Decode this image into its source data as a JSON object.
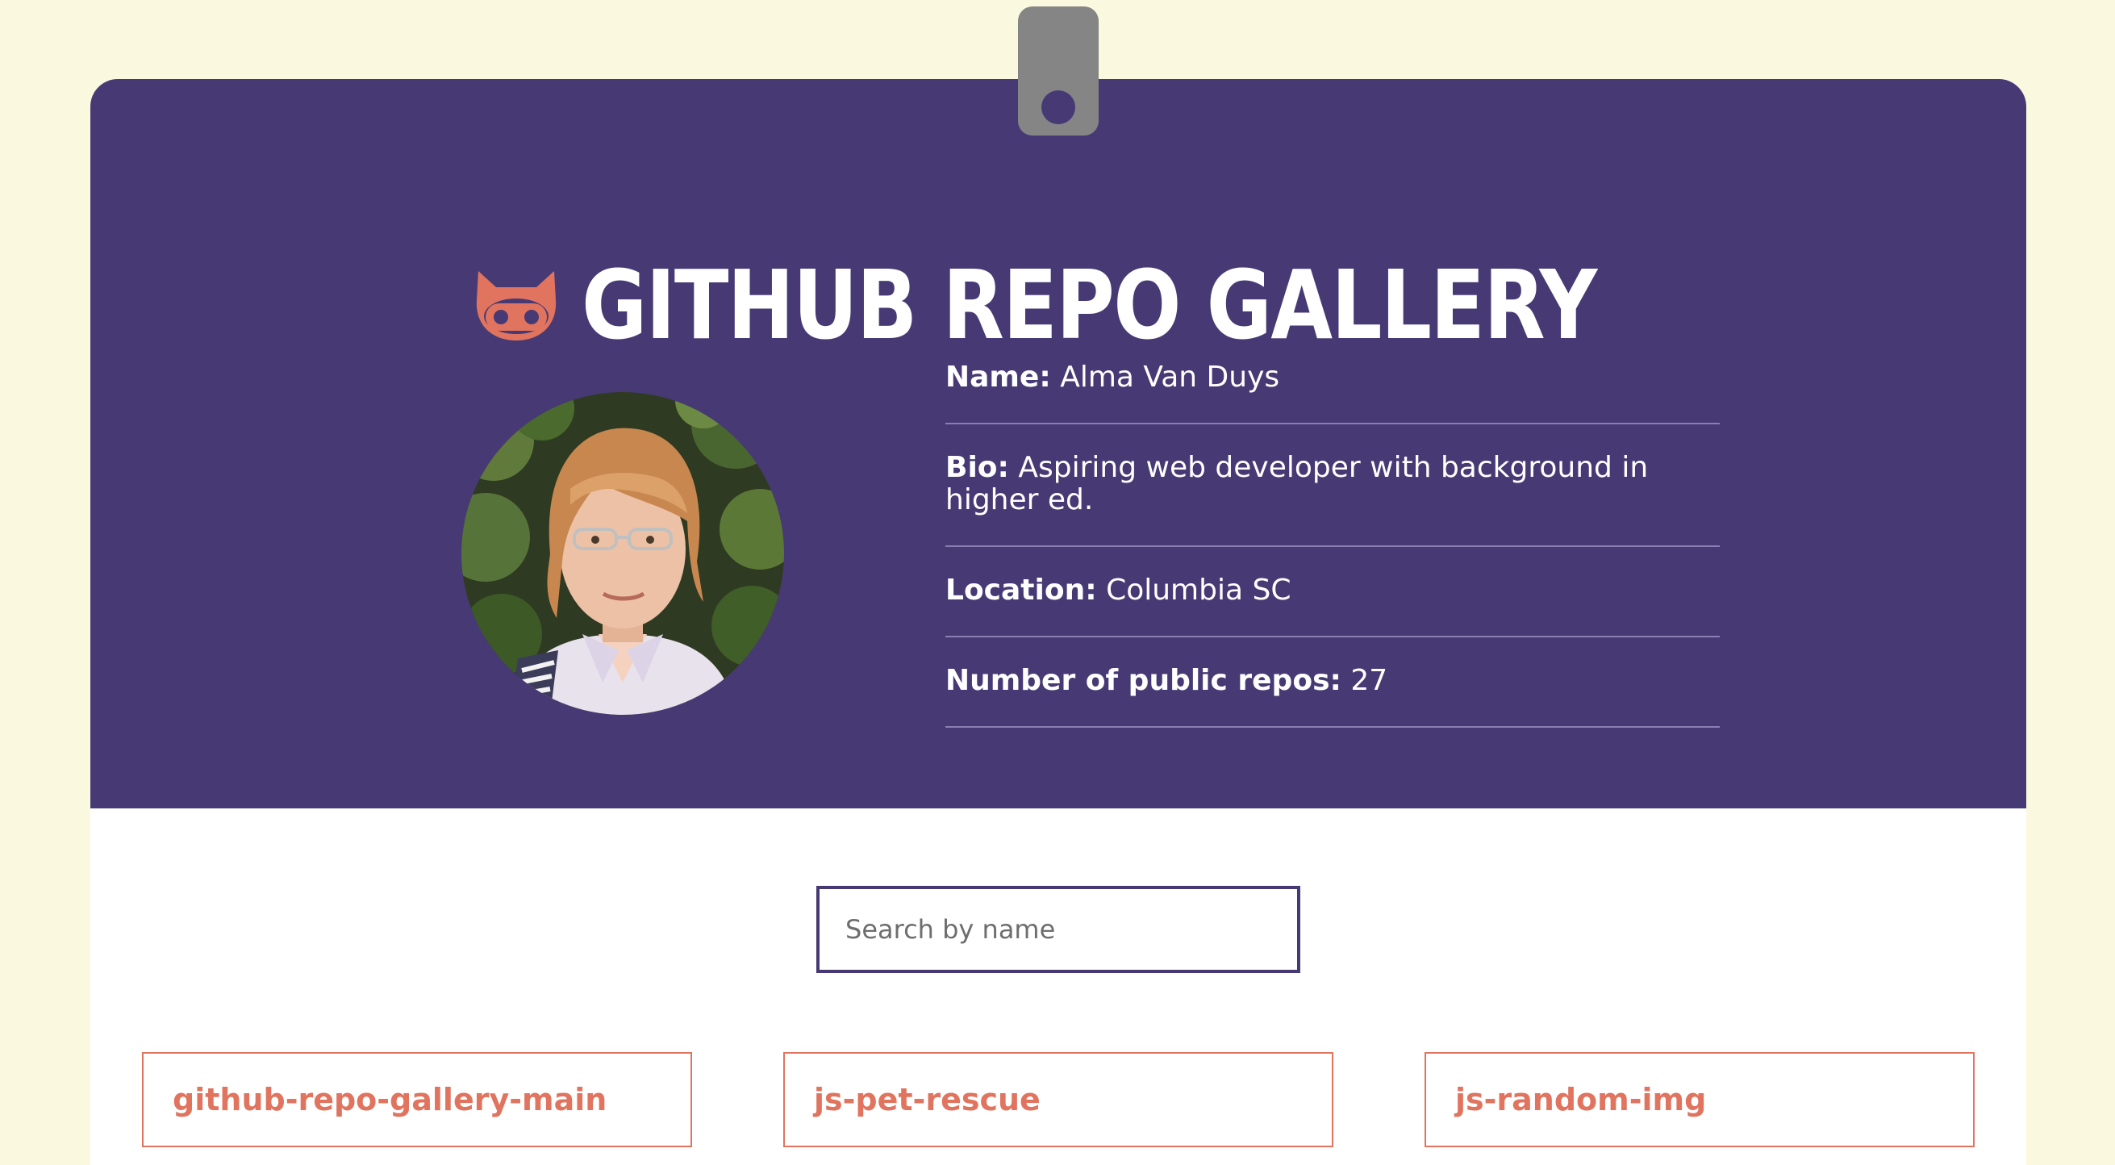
{
  "header": {
    "title": "GITHUB REPO GALLERY",
    "logo_icon": "octocat-icon",
    "background_color": "#473a74",
    "accent_color": "#e0745f"
  },
  "profile": {
    "avatar_alt": "avatar",
    "name_label": "Name:",
    "name_value": "Alma Van Duys",
    "bio_label": "Bio:",
    "bio_value": "Aspiring web developer with background in higher ed.",
    "location_label": "Location:",
    "location_value": "Columbia SC",
    "repos_label": "Number of public repos:",
    "repos_value": "27"
  },
  "search": {
    "placeholder": "Search by name",
    "value": ""
  },
  "repos": [
    {
      "name": "github-repo-gallery-main"
    },
    {
      "name": "js-pet-rescue"
    },
    {
      "name": "js-random-img"
    }
  ]
}
